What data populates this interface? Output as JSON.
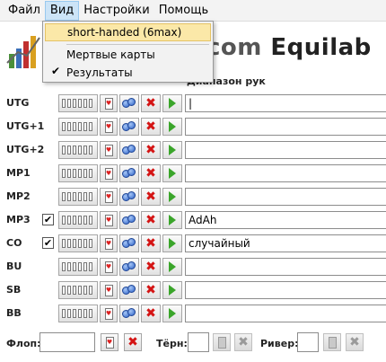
{
  "menu": {
    "items": [
      {
        "label": "Файл"
      },
      {
        "label": "Вид"
      },
      {
        "label": "Настройки"
      },
      {
        "label": "Помощь"
      }
    ]
  },
  "view_menu": {
    "items": [
      {
        "label": "short-handed (6max)",
        "highlighted": true,
        "checked": false
      },
      {
        "label": "Мертвые карты",
        "highlighted": false,
        "checked": false
      },
      {
        "label": "Результаты",
        "highlighted": false,
        "checked": true
      }
    ]
  },
  "header": {
    "title_prefix": "com ",
    "title_brand": "Equilab",
    "column_range": "Диапазон рук"
  },
  "rows": [
    {
      "position": "UTG",
      "has_checkbox": false,
      "checked": false,
      "range": "|"
    },
    {
      "position": "UTG+1",
      "has_checkbox": false,
      "checked": false,
      "range": ""
    },
    {
      "position": "UTG+2",
      "has_checkbox": false,
      "checked": false,
      "range": ""
    },
    {
      "position": "MP1",
      "has_checkbox": false,
      "checked": false,
      "range": ""
    },
    {
      "position": "MP2",
      "has_checkbox": false,
      "checked": false,
      "range": ""
    },
    {
      "position": "MP3",
      "has_checkbox": true,
      "checked": true,
      "range": "AdAh"
    },
    {
      "position": "CO",
      "has_checkbox": true,
      "checked": true,
      "range": "случайный"
    },
    {
      "position": "BU",
      "has_checkbox": false,
      "checked": false,
      "range": ""
    },
    {
      "position": "SB",
      "has_checkbox": false,
      "checked": false,
      "range": ""
    },
    {
      "position": "BB",
      "has_checkbox": false,
      "checked": false,
      "range": ""
    }
  ],
  "board": {
    "flop_label": "Флоп:",
    "turn_label": "Тёрн:",
    "river_label": "Ривер:",
    "flop_value": "",
    "turn_value": "",
    "river_value": ""
  },
  "colors": {
    "menu_active": "#cce4f7",
    "highlight": "#fbe8a8",
    "remove": "#d41414",
    "go": "#3aa52a",
    "chip": "#2d62c8"
  }
}
